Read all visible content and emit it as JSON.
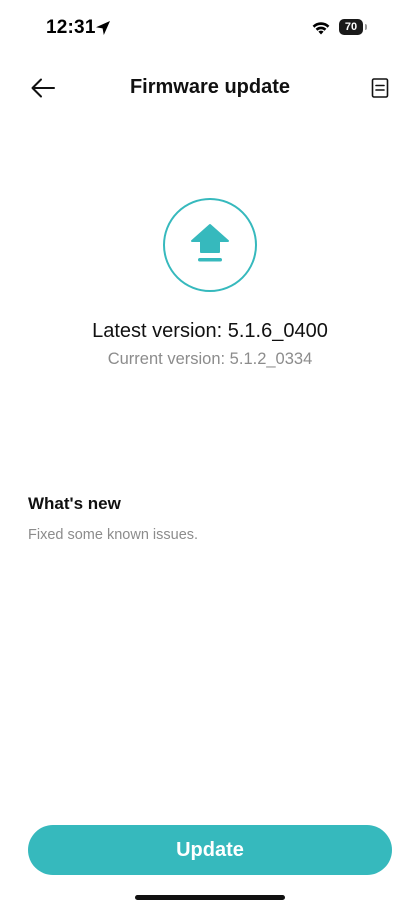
{
  "status_bar": {
    "time": "12:31",
    "battery_level": "70",
    "location_icon": "location-arrow-icon",
    "wifi_icon": "wifi-icon"
  },
  "header": {
    "title": "Firmware update",
    "back_icon": "arrow-left-icon",
    "log_icon": "document-icon"
  },
  "firmware": {
    "badge_icon": "upload-icon",
    "latest_version": "Latest version: 5.1.6_0400",
    "current_version": "Current version: 5.1.2_0334"
  },
  "whats_new": {
    "heading": "What's new",
    "body": "Fixed some known issues."
  },
  "actions": {
    "update_label": "Update"
  },
  "colors": {
    "accent": "#36b9bd",
    "secondary_text": "#8c8c8c",
    "primary_text": "#111111"
  }
}
